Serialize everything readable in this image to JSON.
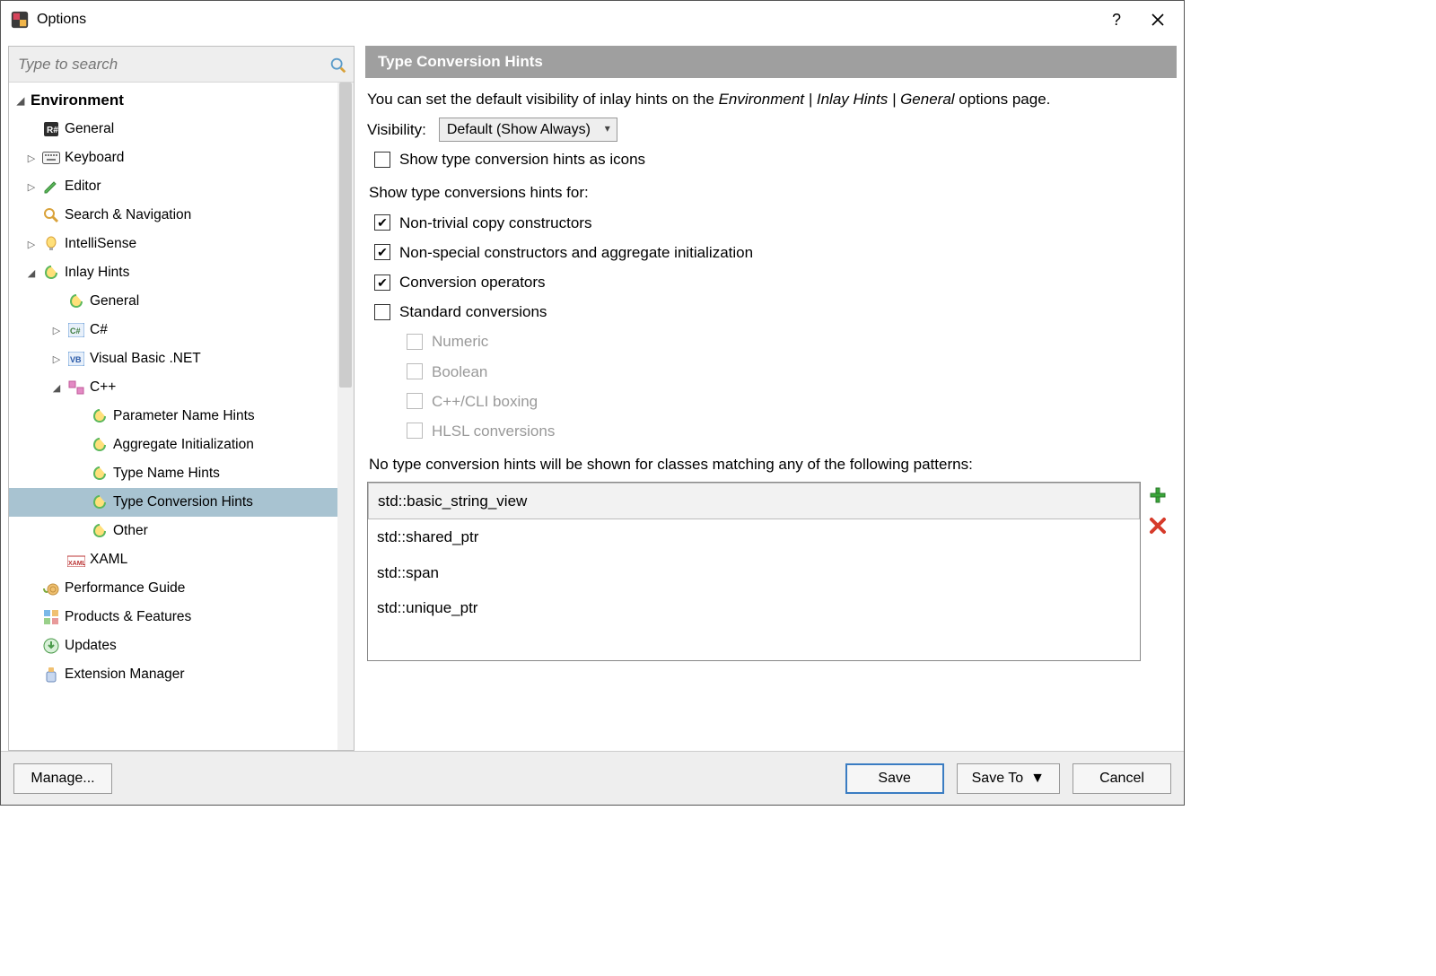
{
  "window": {
    "title": "Options"
  },
  "search": {
    "placeholder": "Type to search"
  },
  "tree": {
    "environment": "Environment",
    "general": "General",
    "keyboard": "Keyboard",
    "editor": "Editor",
    "search_nav": "Search & Navigation",
    "intellisense": "IntelliSense",
    "inlay_hints": "Inlay Hints",
    "ih_general": "General",
    "csharp": "C#",
    "vbnet": "Visual Basic .NET",
    "cpp": "C++",
    "param_hints": "Parameter Name Hints",
    "agg_init": "Aggregate Initialization",
    "type_name_hints": "Type Name Hints",
    "type_conv_hints": "Type Conversion Hints",
    "other": "Other",
    "xaml": "XAML",
    "perf_guide": "Performance Guide",
    "products": "Products & Features",
    "updates": "Updates",
    "ext_mgr": "Extension Manager"
  },
  "panel": {
    "title": "Type Conversion Hints",
    "intro_pre": "You can set the default visibility of inlay hints on the ",
    "intro_em": "Environment | Inlay Hints | General",
    "intro_post": " options page.",
    "visibility_label": "Visibility:",
    "visibility_value": "Default (Show Always)",
    "as_icons": "Show type conversion hints as icons",
    "show_for": "Show type conversions hints for:",
    "opt_nontrivial": "Non-trivial copy constructors",
    "opt_nonspecial": "Non-special constructors and aggregate initialization",
    "opt_convops": "Conversion operators",
    "opt_std": "Standard conversions",
    "opt_numeric": "Numeric",
    "opt_boolean": "Boolean",
    "opt_cli": "C++/CLI boxing",
    "opt_hlsl": "HLSL conversions",
    "exclude_label": "No type conversion hints will be shown for classes matching any of the following patterns:",
    "patterns": [
      "std::basic_string_view",
      "std::shared_ptr",
      "std::span",
      "std::unique_ptr"
    ]
  },
  "footer": {
    "manage": "Manage...",
    "save": "Save",
    "save_to": "Save To",
    "cancel": "Cancel"
  }
}
